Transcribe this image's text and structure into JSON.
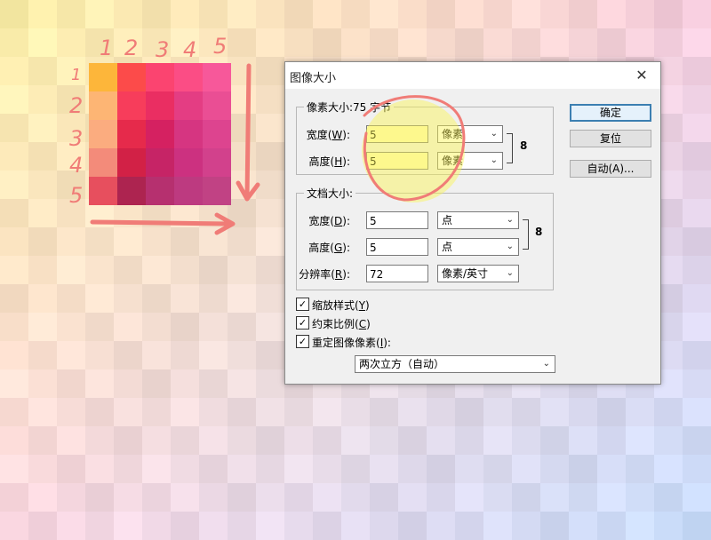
{
  "dialog": {
    "title": "图像大小",
    "close_glyph": "✕",
    "pixel_dims": {
      "title": "像素大小:75 字节",
      "width_label": "宽度(",
      "width_key": "W",
      "label_close": "):",
      "width_value": "5",
      "width_unit": "像素",
      "height_label": "高度(",
      "height_key": "H",
      "height_value": "5",
      "height_unit": "像素"
    },
    "doc_size": {
      "title": "文档大小:",
      "width_label": "宽度(",
      "width_key": "D",
      "label_close": "):",
      "width_value": "5",
      "width_unit": "点",
      "height_label": "高度(",
      "height_key": "G",
      "height_value": "5",
      "height_unit": "点",
      "res_label": "分辨率(",
      "res_key": "R",
      "res_value": "72",
      "res_unit": "像素/英寸"
    },
    "checkboxes": [
      {
        "label": "缩放样式(",
        "key": "Y",
        "tail": ")",
        "checked": true
      },
      {
        "label": "约束比例(",
        "key": "C",
        "tail": ")",
        "checked": true
      },
      {
        "label": "重定图像像素(",
        "key": "I",
        "tail": "):",
        "checked": true
      }
    ],
    "resample_method": "两次立方（自动）",
    "buttons": {
      "ok": "确定",
      "reset": "复位",
      "auto": "自动(A)..."
    },
    "check_glyph": "✓",
    "chevron_glyph": "⌄",
    "link_glyph": "8"
  },
  "annotations": {
    "col_numbers": [
      "1",
      "2",
      "3",
      "4",
      "5"
    ],
    "row_numbers": [
      "1",
      "2",
      "3",
      "4",
      "5"
    ],
    "color": "#f07c77"
  },
  "grid5_colors": [
    [
      "#fdb63a",
      "#fc4b4a",
      "#fb4470",
      "#fb4d85",
      "#f7589a"
    ],
    [
      "#fdb574",
      "#f73d5b",
      "#ea2e62",
      "#e43d83",
      "#ea4e94"
    ],
    [
      "#fbac7f",
      "#e62a4b",
      "#d52161",
      "#d63581",
      "#dd448f"
    ],
    [
      "#f38b7a",
      "#d22146",
      "#c62466",
      "#cc3180",
      "#d2418c"
    ],
    [
      "#e74f5e",
      "#ad2450",
      "#b6306f",
      "#bd3a80",
      "#c14284"
    ]
  ]
}
